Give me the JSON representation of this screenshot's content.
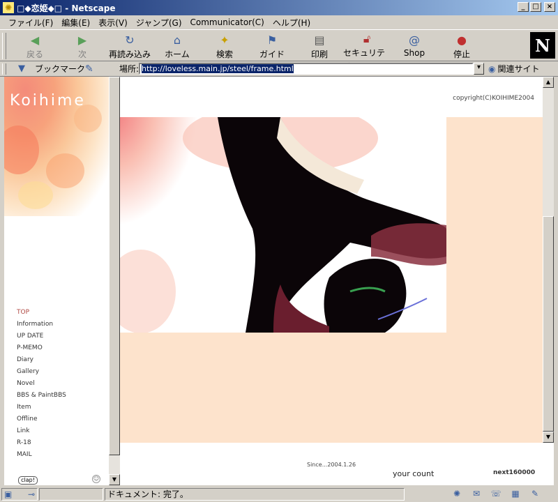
{
  "window": {
    "title": "□◆恋姫◆□ - Netscape",
    "controls": [
      "_",
      "□",
      "×"
    ]
  },
  "menu": [
    "ファイル(F)",
    "編集(E)",
    "表示(V)",
    "ジャンプ(G)",
    "Communicator(C)",
    "ヘルプ(H)"
  ],
  "toolbar": {
    "buttons": [
      {
        "label": "戻る",
        "icon": "back-arrow-icon"
      },
      {
        "label": "次",
        "icon": "forward-arrow-icon"
      },
      {
        "label": "再読み込み",
        "icon": "reload-icon"
      },
      {
        "label": "ホーム",
        "icon": "home-icon"
      },
      {
        "label": "検索",
        "icon": "search-icon"
      },
      {
        "label": "ガイド",
        "icon": "guide-icon"
      },
      {
        "label": "印刷",
        "icon": "print-icon"
      },
      {
        "label": "セキュリティ",
        "icon": "lock-icon"
      },
      {
        "label": "Shop",
        "icon": "shop-icon"
      },
      {
        "label": "停止",
        "icon": "stop-icon"
      }
    ],
    "logo": "N"
  },
  "location_bar": {
    "bookmarks_label": "ブックマーク",
    "location_label": "場所:",
    "url": "http://loveless.main.jp/steel/frame.html",
    "related_label": "関連サイト"
  },
  "left_frame": {
    "brand": "Koihime",
    "nav": [
      "TOP",
      "Information",
      "UP DATE",
      "P-MEMO",
      "Diary",
      "Gallery",
      "Novel",
      "BBS & PaintBBS",
      "Item",
      "Offline",
      "Link",
      "R-18",
      "MAIL"
    ],
    "active_item": "TOP",
    "clap_label": "clap!"
  },
  "main_frame": {
    "copyright": "copyright(C)KOIHIME2004"
  },
  "footer": {
    "since": "Since...2004.1.26",
    "your_count": "your count",
    "next_count": "next160000"
  },
  "status_bar": {
    "message": "ドキュメント: 完了。"
  },
  "colors": {
    "titlebar": "#0a246a",
    "peach": "#fde3cc",
    "active_nav": "#b04a44"
  }
}
